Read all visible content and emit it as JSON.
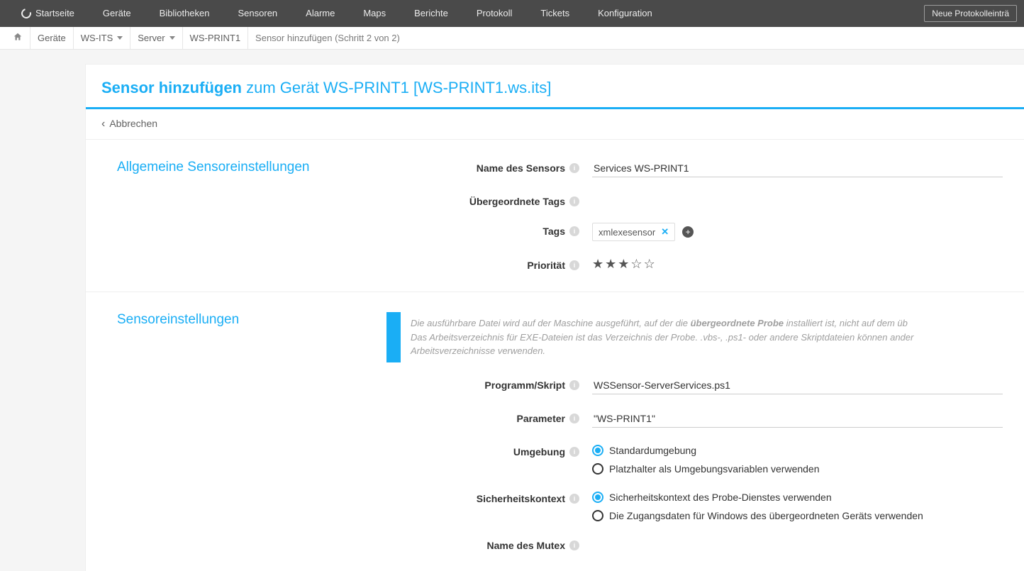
{
  "topnav": {
    "items": [
      "Startseite",
      "Geräte",
      "Bibliotheken",
      "Sensoren",
      "Alarme",
      "Maps",
      "Berichte",
      "Protokoll",
      "Tickets",
      "Konfiguration"
    ],
    "button": "Neue Protokolleinträ"
  },
  "breadcrumb": {
    "items": [
      {
        "label": "",
        "icon": "home"
      },
      {
        "label": "Geräte"
      },
      {
        "label": "WS-ITS",
        "dropdown": true
      },
      {
        "label": "Server",
        "dropdown": true
      },
      {
        "label": "WS-PRINT1"
      },
      {
        "label": "Sensor hinzufügen (Schritt 2 von 2)"
      }
    ]
  },
  "page": {
    "title_bold": "Sensor hinzufügen",
    "title_rest": " zum Gerät WS-PRINT1 [WS-PRINT1.ws.its]",
    "back": "Abbrechen"
  },
  "section1": {
    "title": "Allgemeine Sensoreinstellungen",
    "labels": {
      "name": "Name des Sensors",
      "parent_tags": "Übergeordnete Tags",
      "tags": "Tags",
      "priority": "Priorität"
    },
    "name_value": "Services WS-PRINT1",
    "tag": "xmlexesensor",
    "priority": {
      "filled": 3,
      "total": 5
    }
  },
  "section2": {
    "title": "Sensoreinstellungen",
    "info_pre": "Die ausführbare Datei wird auf der Maschine ausgeführt, auf der die ",
    "info_bold": "übergeordnete Probe",
    "info_post": " installiert ist, nicht auf dem üb",
    "info_line2": "Das Arbeitsverzeichnis für EXE-Dateien ist das Verzeichnis der Probe. .vbs-, .ps1- oder andere Skriptdateien können ander",
    "info_line3": "Arbeitsverzeichnisse verwenden.",
    "labels": {
      "program": "Programm/Skript",
      "parameter": "Parameter",
      "env": "Umgebung",
      "sec": "Sicherheitskontext",
      "mutex": "Name des Mutex"
    },
    "program_value": "WSSensor-ServerServices.ps1",
    "parameter_value": "\"WS-PRINT1\"",
    "env_options": [
      "Standardumgebung",
      "Platzhalter als Umgebungsvariablen verwenden"
    ],
    "sec_options": [
      "Sicherheitskontext des Probe-Dienstes verwenden",
      "Die Zugangsdaten für Windows des übergeordneten Geräts verwenden"
    ]
  }
}
